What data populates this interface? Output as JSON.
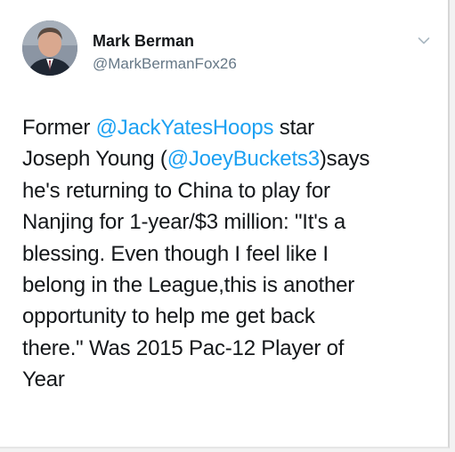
{
  "tweet": {
    "author": {
      "display_name": "Mark Berman",
      "handle": "@MarkBermanFox26"
    },
    "text_lines": {
      "l1_a": "Former ",
      "l1_mention": "@JackYatesHoops",
      "l1_b": " star",
      "l2_a": "Joseph Young (",
      "l2_mention": "@JoeyBuckets3",
      "l2_b": ")says",
      "l3": "he's returning to China to play for",
      "l4": "Nanjing for 1-year/$3 million: \"It's a",
      "l5": "blessing. Even though I feel like I",
      "l6": "belong in the League,this is another",
      "l7": "opportunity to help me get back",
      "l8": "there.\" Was  2015 Pac-12 Player of",
      "l9": "Year"
    },
    "icons": {
      "menu": "chevron-down-icon",
      "avatar": "profile-photo"
    },
    "colors": {
      "mention": "#1da1f2",
      "text": "#14171a",
      "handle": "#657786"
    }
  }
}
